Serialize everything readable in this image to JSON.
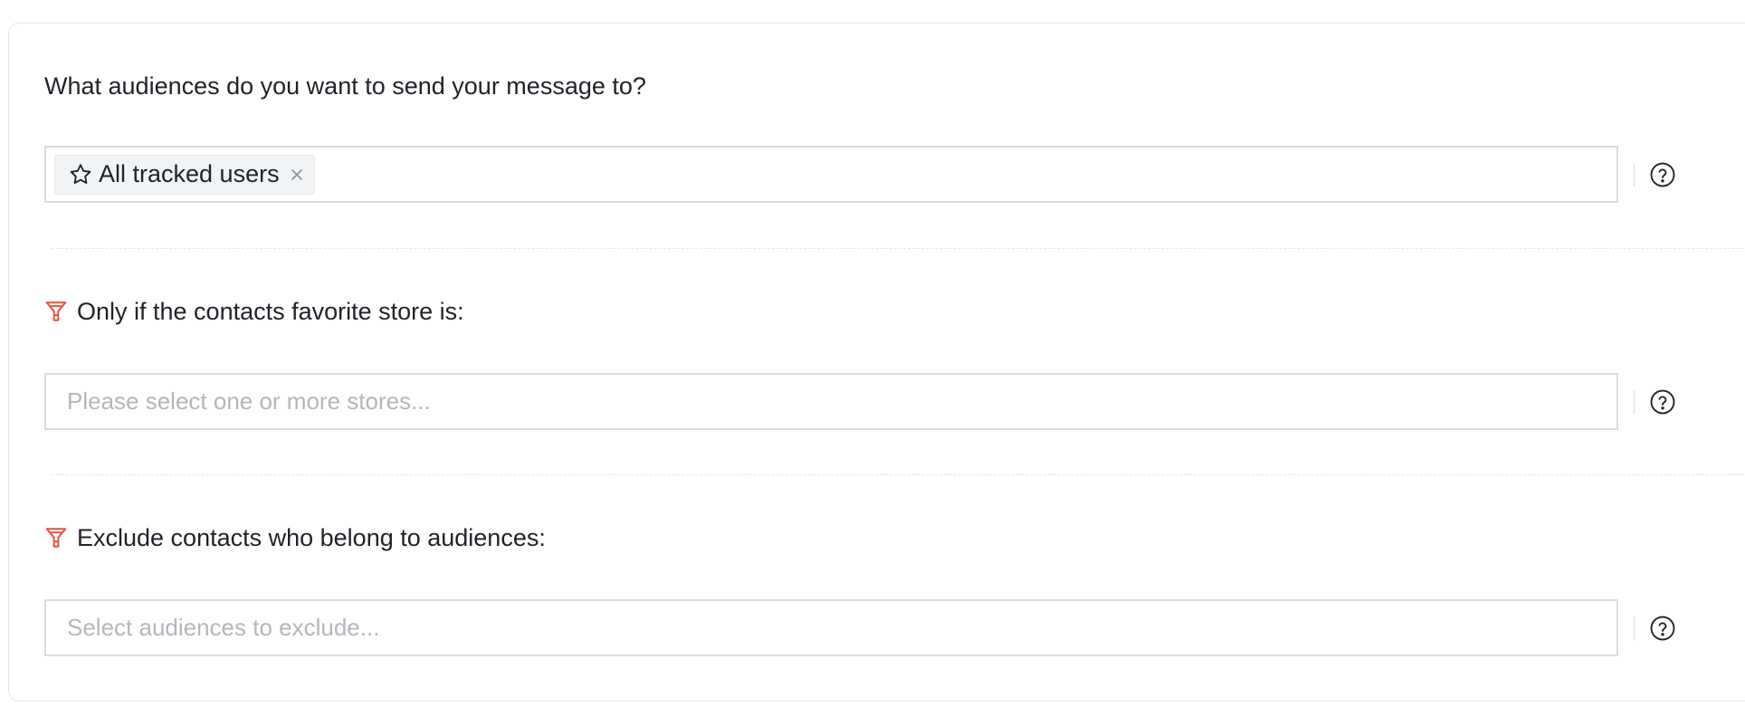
{
  "audiences": {
    "title": "What audiences do you want to send your message to?",
    "selected_tags": [
      {
        "label": "All tracked users",
        "icon": "star-outline-icon"
      }
    ],
    "help_icon": "question-circle-icon"
  },
  "favorite_store": {
    "title": "Only if the contacts favorite store is:",
    "title_icon": "filter-icon",
    "placeholder": "Please select one or more stores...",
    "help_icon": "question-circle-icon"
  },
  "exclude": {
    "title": "Exclude contacts who belong to audiences:",
    "title_icon": "filter-icon",
    "placeholder": "Select audiences to exclude...",
    "help_icon": "question-circle-icon"
  },
  "colors": {
    "filter_icon": "#e8503a",
    "border": "#d9dce0",
    "placeholder": "#b3b7bc",
    "tag_bg": "#f2f3f4"
  }
}
